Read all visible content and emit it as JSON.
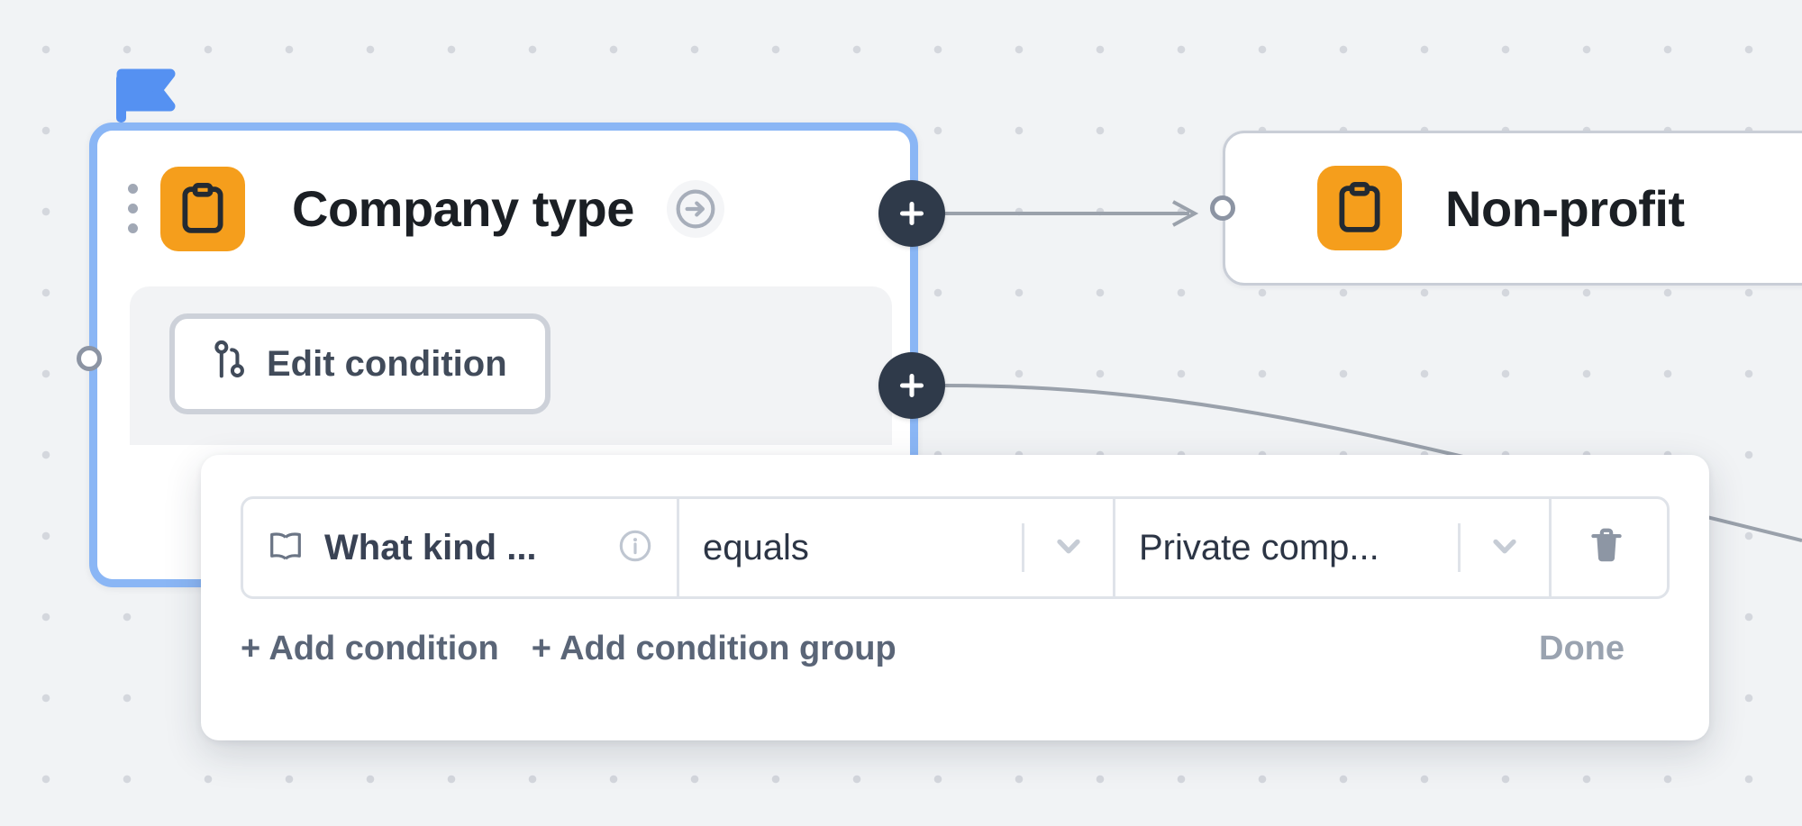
{
  "canvas": {
    "background_color": "#f1f3f5",
    "dot_color": "#d4d7dd"
  },
  "nodes": [
    {
      "id": "company-type",
      "title": "Company type",
      "icon": "clipboard-icon",
      "icon_bg": "#f59e1c",
      "selected": true,
      "selection_color": "#8ab6f5",
      "flag": "flag-icon",
      "drag_handle": "drag-handle-icon",
      "goto_icon": "arrow-right-circle-icon",
      "edit_condition_label": "Edit condition",
      "edit_condition_icon": "git-branch-icon",
      "add_branch_icon": "plus-icon"
    },
    {
      "id": "non-profit",
      "title": "Non-profit",
      "icon": "clipboard-icon",
      "icon_bg": "#f59e1c",
      "selected": false
    }
  ],
  "handles": {
    "plus_label": "+",
    "plus_color": "#2f3a4a"
  },
  "condition_popup": {
    "rows": [
      {
        "field_icon": "book-open-icon",
        "field": "What kind ...",
        "info_icon": "info-circle-icon",
        "operator": "equals",
        "operator_chevron": "chevron-down-icon",
        "value": "Private comp...",
        "value_chevron": "chevron-down-icon",
        "delete_icon": "trash-icon"
      }
    ],
    "add_condition_label": "+ Add condition",
    "add_condition_group_label": "+ Add condition group",
    "done_label": "Done"
  }
}
